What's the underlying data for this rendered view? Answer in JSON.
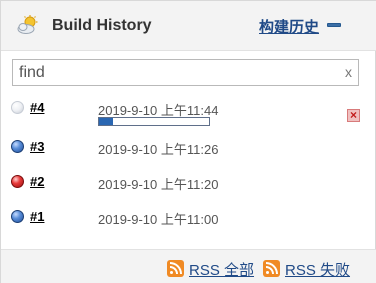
{
  "header": {
    "title": "Build History",
    "trend_link": "构建历史",
    "weather_icon": "cloudy-sun-icon",
    "collapse_icon": "minus-icon"
  },
  "search": {
    "placeholder": "find",
    "clear_label": "x"
  },
  "builds": [
    {
      "number": "#4",
      "time": "2019-9-10 上午11:44",
      "status": "in-progress",
      "progress_percent": 13
    },
    {
      "number": "#3",
      "time": "2019-9-10 上午11:26",
      "status": "success"
    },
    {
      "number": "#2",
      "time": "2019-9-10 上午11:20",
      "status": "failed"
    },
    {
      "number": "#1",
      "time": "2019-9-10 上午11:00",
      "status": "success"
    }
  ],
  "footer": {
    "rss_all": "RSS 全部",
    "rss_failed": "RSS 失败"
  },
  "colors": {
    "link": "#204a87",
    "success": "#2f5fad",
    "failed": "#d62828",
    "rss": "#f08a24"
  }
}
